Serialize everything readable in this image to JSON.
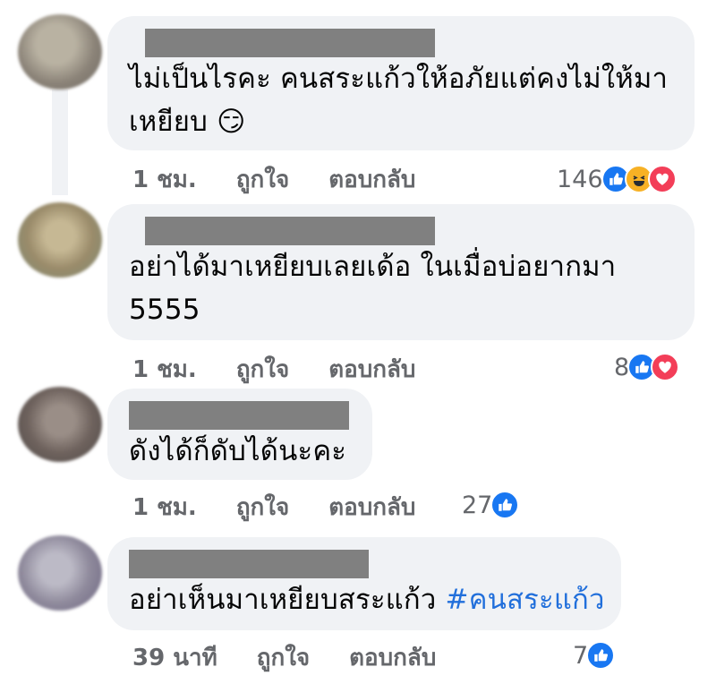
{
  "comments": [
    {
      "text_lines": [
        "ไม่เป็นไรคะ คนสระแก้วให้อภัยแต่คงไม่ให้มา",
        "เหยียบ 😏"
      ],
      "time": "1 ชม.",
      "like": "ถูกใจ",
      "reply": "ตอบกลับ",
      "reaction_count": "146",
      "reactions": [
        "like-icon",
        "haha-icon",
        "love-icon"
      ]
    },
    {
      "text_lines": [
        "อย่าได้มาเหยียบเลยเด้อ ในเมื่อบ่อยากมา",
        "5555"
      ],
      "time": "1 ชม.",
      "like": "ถูกใจ",
      "reply": "ตอบกลับ",
      "reaction_count": "8",
      "reactions": [
        "like-icon",
        "love-icon"
      ]
    },
    {
      "text_lines": [
        "ดังได้ก็ดับได้นะคะ"
      ],
      "time": "1 ชม.",
      "like": "ถูกใจ",
      "reply": "ตอบกลับ",
      "reaction_count": "27",
      "reactions": [
        "like-icon"
      ]
    },
    {
      "text_plain": "อย่าเห็นมาเหยียบสระแก้ว ",
      "hashtag": "#คนสระแก้ว",
      "time": "39 นาที",
      "like": "ถูกใจ",
      "reply": "ตอบกลับ",
      "reaction_count": "7",
      "reactions": [
        "like-icon"
      ]
    }
  ],
  "colors": {
    "bubble": "#f0f2f5",
    "meta_text": "#65676b",
    "hashtag": "#216fdb",
    "like": "#1877f2",
    "haha": "#f7b125",
    "love": "#f33e58"
  }
}
